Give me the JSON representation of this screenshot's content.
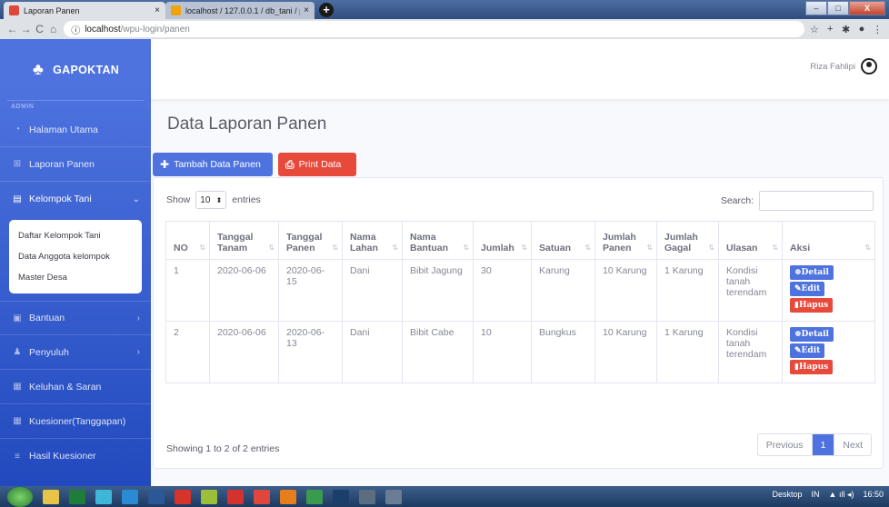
{
  "browser": {
    "tabs": [
      {
        "title": "Laporan Panen",
        "close": "×",
        "color": "#e0473c"
      },
      {
        "title": "localhost / 127.0.0.1 / db_tani / p",
        "close": "×",
        "color": "#f0a30a"
      }
    ],
    "new_tab": "+",
    "window_buttons": {
      "minimize": "–",
      "maximize": "□",
      "close": "X"
    },
    "url_host": "localhost",
    "url_path": "/wpu-login/panen"
  },
  "sidebar": {
    "brand": "GAPOKTAN",
    "heading": "ADMIN",
    "items": [
      {
        "label": "Halaman Utama",
        "icon": "tachometer-icon"
      },
      {
        "label": "Laporan Panen",
        "icon": "cart-icon"
      },
      {
        "label": "Kelompok Tani",
        "icon": "id-card-icon",
        "chev": "⌄"
      },
      {
        "label": "Bantuan",
        "icon": "gift-icon",
        "chev": "›"
      },
      {
        "label": "Penyuluh",
        "icon": "user-icon",
        "chev": "›"
      },
      {
        "label": "Keluhan & Saran",
        "icon": "table-icon"
      },
      {
        "label": "Kuesioner(Tanggapan)",
        "icon": "table-icon"
      },
      {
        "label": "Hasil Kuesioner",
        "icon": "list-icon"
      }
    ],
    "submenu": [
      "Daftar Kelompok Tani",
      "Data Anggota kelompok",
      "Master Desa"
    ]
  },
  "topbar": {
    "user_name": "Riza Fahlipi"
  },
  "main": {
    "title": "Data Laporan Panen",
    "add_button": "Tambah Data Panen",
    "print_button": "Print Data",
    "show_label": "Show",
    "entries_value": "10",
    "entries_label": "entries",
    "search_label": "Search:",
    "columns": [
      "NO",
      "Tanggal Tanam",
      "Tanggal Panen",
      "Nama Lahan",
      "Nama Bantuan",
      "Jumlah",
      "Satuan",
      "Jumlah Panen",
      "Jumlah Gagal",
      "Ulasan",
      "Aksi"
    ],
    "rows": [
      {
        "no": "1",
        "tanam": "2020-06-06",
        "panen": "2020-06-15",
        "lahan": "Dani",
        "bantuan": "Bibit Jagung",
        "jumlah": "30",
        "satuan": "Karung",
        "jml_panen": "10 Karung",
        "jml_gagal": "1 Karung",
        "ulasan": "Kondisi tanah terendam"
      },
      {
        "no": "2",
        "tanam": "2020-06-06",
        "panen": "2020-06-13",
        "lahan": "Dani",
        "bantuan": "Bibit Cabe",
        "jumlah": "10",
        "satuan": "Bungkus",
        "jml_panen": "10 Karung",
        "jml_gagal": "1 Karung",
        "ulasan": "Kondisi tanah terendam"
      }
    ],
    "actions": {
      "detail": "Detail",
      "edit": "Edit",
      "hapus": "Hapus"
    },
    "info": "Showing 1 to 2 of 2 entries",
    "pager": {
      "prev": "Previous",
      "current": "1",
      "next": "Next"
    }
  },
  "taskbar": {
    "desktop": "Desktop",
    "lang": "IN",
    "time": "16:50"
  }
}
